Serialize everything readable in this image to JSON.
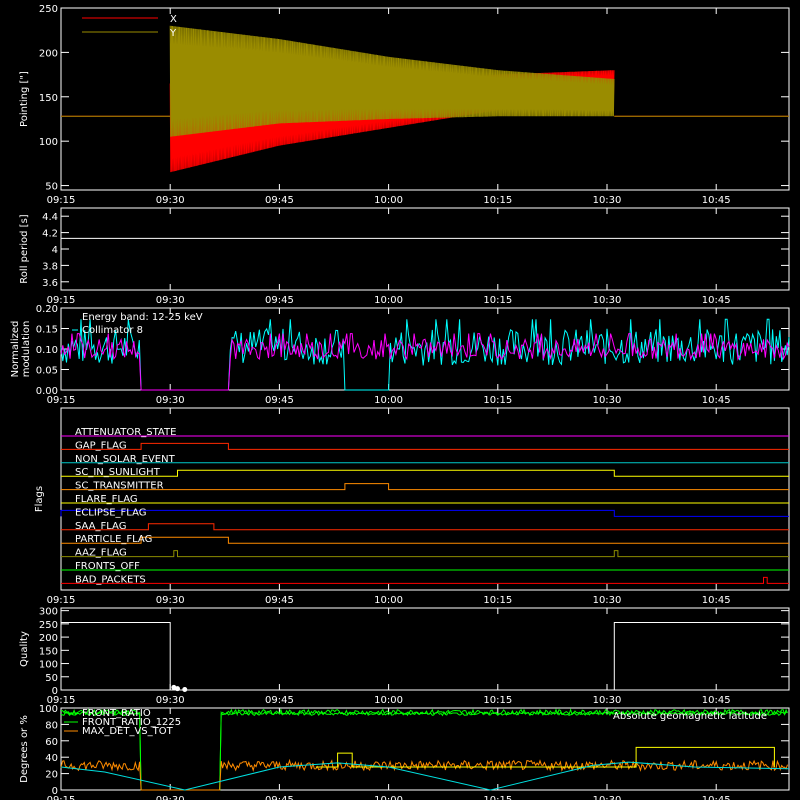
{
  "time_axis": {
    "domain_min": "09:15",
    "domain_max": "10:55",
    "ticks": [
      "09:15",
      "09:30",
      "09:45",
      "10:00",
      "10:15",
      "10:30",
      "10:45"
    ]
  },
  "chart_data": [
    {
      "type": "line",
      "panel": "pointing",
      "ylabel": "Pointing [\"]",
      "ylim": [
        45,
        250
      ],
      "yticks": [
        50,
        100,
        150,
        200,
        250
      ],
      "legend_position": "top-left",
      "series": [
        {
          "name": "X",
          "color": "#ff0000",
          "baseline": 128,
          "start": "09:30",
          "end": "10:31",
          "envelope": [
            {
              "t": "09:30",
              "lo": 65,
              "hi": 165
            },
            {
              "t": "09:45",
              "lo": 95,
              "hi": 160
            },
            {
              "t": "10:00",
              "lo": 115,
              "hi": 165
            },
            {
              "t": "10:15",
              "lo": 135,
              "hi": 175
            },
            {
              "t": "10:31",
              "lo": 145,
              "hi": 180
            }
          ]
        },
        {
          "name": "Y",
          "color": "#9a8c00",
          "baseline": 128,
          "start": "09:30",
          "end": "10:31",
          "envelope": [
            {
              "t": "09:30",
              "lo": 105,
              "hi": 230
            },
            {
              "t": "09:45",
              "lo": 120,
              "hi": 215
            },
            {
              "t": "10:00",
              "lo": 125,
              "hi": 195
            },
            {
              "t": "10:15",
              "lo": 128,
              "hi": 180
            },
            {
              "t": "10:31",
              "lo": 128,
              "hi": 170
            }
          ]
        }
      ]
    },
    {
      "type": "line",
      "panel": "roll",
      "ylabel": "Roll period [s]",
      "ylim": [
        3.5,
        4.5
      ],
      "yticks": [
        3.6,
        3.8,
        4.0,
        4.2,
        4.4
      ],
      "series": [
        {
          "color": "#ffffff",
          "points": [
            {
              "t": "09:15",
              "v": 4.13
            },
            {
              "t": "10:55",
              "v": 4.13
            }
          ]
        }
      ]
    },
    {
      "type": "line",
      "panel": "modulation",
      "ylabel": "Normalized modulation",
      "ylim": [
        0,
        0.2
      ],
      "yticks": [
        "0.00",
        "0.05",
        "0.10",
        "0.15",
        "0.20"
      ],
      "annotation": "Energy band: 12-25 keV",
      "series": [
        {
          "name": "Collimator 8",
          "color": "#00ffff",
          "level": 0.105,
          "spread": 0.045,
          "gaps": [
            [
              "09:26",
              "09:38"
            ],
            [
              "09:54",
              "10:00"
            ]
          ]
        },
        {
          "name": "",
          "color": "#ff00ff",
          "level": 0.1,
          "spread": 0.025,
          "gaps": [
            [
              "09:26",
              "09:38"
            ]
          ]
        }
      ]
    },
    {
      "type": "line",
      "panel": "flags",
      "ylabel": "Flags",
      "flags": [
        {
          "label": "ATTENUATOR_STATE",
          "color": "#ff00ff",
          "on": []
        },
        {
          "label": "GAP_FLAG",
          "color": "#ff2a00",
          "on": [
            [
              "09:26",
              "09:38"
            ]
          ]
        },
        {
          "label": "NON_SOLAR_EVENT",
          "color": "#00c8c8",
          "on": []
        },
        {
          "label": "SC_IN_SUNLIGHT",
          "color": "#ffff00",
          "on": [
            [
              "09:31",
              "10:31"
            ]
          ]
        },
        {
          "label": "SC_TRANSMITTER",
          "color": "#ff8c00",
          "on": [
            [
              "09:54",
              "10:00"
            ]
          ]
        },
        {
          "label": "FLARE_FLAG",
          "color": "#ffff00",
          "on": []
        },
        {
          "label": "ECLIPSE_FLAG",
          "color": "#0000ff",
          "on": [
            [
              "09:15",
              "10:31"
            ]
          ]
        },
        {
          "label": "SAA_FLAG",
          "color": "#ff2a00",
          "on": [
            [
              "09:27",
              "09:36"
            ]
          ]
        },
        {
          "label": "PARTICLE_FLAG",
          "color": "#ff8c00",
          "on": [
            [
              "09:26",
              "09:38"
            ]
          ]
        },
        {
          "label": "AAZ_FLAG",
          "color": "#8c8c00",
          "on": [
            [
              "09:30.5",
              "09:31"
            ],
            [
              "10:31",
              "10:31.5"
            ]
          ]
        },
        {
          "label": "FRONTS_OFF",
          "color": "#00ff00",
          "on": []
        },
        {
          "label": "BAD_PACKETS",
          "color": "#ff0000",
          "on": [
            [
              "10:51.5",
              "10:52"
            ]
          ]
        }
      ]
    },
    {
      "type": "line",
      "panel": "quality",
      "ylabel": "Quality",
      "ylim": [
        0,
        310
      ],
      "yticks": [
        0,
        50,
        100,
        150,
        200,
        250,
        300
      ],
      "series": [
        {
          "color": "#ffffff",
          "points": [
            {
              "t": "09:15",
              "v": 255
            },
            {
              "t": "09:30",
              "v": 255
            },
            {
              "t": "09:30",
              "v": 0
            },
            {
              "t": "10:31",
              "v": 0
            },
            {
              "t": "10:31",
              "v": 255
            },
            {
              "t": "10:55",
              "v": 255
            }
          ],
          "dots": [
            {
              "t": "09:30.5",
              "v": 10
            },
            {
              "t": "09:31",
              "v": 5
            },
            {
              "t": "09:32",
              "v": 2
            }
          ]
        }
      ]
    },
    {
      "type": "line",
      "panel": "degrees",
      "ylabel": "Degrees or %",
      "ylim": [
        0,
        100
      ],
      "yticks": [
        0,
        20,
        40,
        60,
        80,
        100
      ],
      "series": [
        {
          "name": "FRONT_RATIO",
          "color": "#00ff00",
          "style": "noisy",
          "level": 95,
          "spread": 3,
          "gaps": [
            [
              "09:26",
              "09:37"
            ]
          ]
        },
        {
          "name": "FRONT_RATIO_1225",
          "color": "#00ff00",
          "style": "noisy",
          "level": 93,
          "spread": 2,
          "gaps": [
            [
              "09:26",
              "09:37"
            ]
          ]
        },
        {
          "name": "MAX_DET_VS_TOT",
          "color": "#ff8c00",
          "style": "noisy",
          "level": 30,
          "spread": 6,
          "gaps": [
            [
              "09:26",
              "09:37"
            ]
          ]
        },
        {
          "name": "",
          "color": "#ffff00",
          "style": "steps",
          "points": [
            {
              "t": "09:50",
              "v": 28
            },
            {
              "t": "09:53",
              "v": 28
            },
            {
              "t": "09:53",
              "v": 45
            },
            {
              "t": "09:55",
              "v": 45
            },
            {
              "t": "09:55",
              "v": 28
            },
            {
              "t": "10:34",
              "v": 28
            },
            {
              "t": "10:34",
              "v": 52
            },
            {
              "t": "10:53",
              "v": 52
            },
            {
              "t": "10:53",
              "v": 28
            }
          ]
        },
        {
          "name": "Absolute geomagnetic latitude",
          "color": "#00dede",
          "style": "smooth",
          "points": [
            {
              "t": "09:15",
              "v": 28
            },
            {
              "t": "09:21",
              "v": 22
            },
            {
              "t": "09:32",
              "v": 0
            },
            {
              "t": "09:45",
              "v": 28
            },
            {
              "t": "09:53",
              "v": 33
            },
            {
              "t": "10:00",
              "v": 28
            },
            {
              "t": "10:14",
              "v": 0
            },
            {
              "t": "10:28",
              "v": 30
            },
            {
              "t": "10:33",
              "v": 34
            },
            {
              "t": "10:42",
              "v": 28
            },
            {
              "t": "10:55",
              "v": 26
            }
          ]
        }
      ]
    }
  ]
}
